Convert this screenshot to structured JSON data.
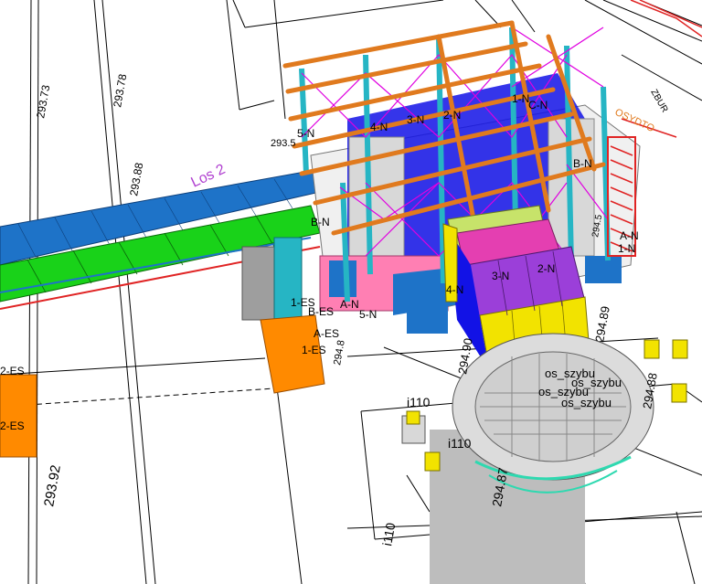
{
  "view": {
    "background": "#ffffff",
    "colors": {
      "bridge_deck": "#1e73c8",
      "bridge_truss": "#19d219",
      "beam": "#e07a1e",
      "column": "#26b5c4",
      "magenta": "#e000e0",
      "blue_panel": "#1212e6",
      "yellow_block": "#f2e300",
      "purple_block": "#9b3fd9",
      "pink_block": "#e43fb1",
      "orange_block": "#ff8a00",
      "silo": "#bdbdbd",
      "teal_dish": "#2ed9b0",
      "red_rail": "#e02424",
      "grey_panel": "#d8d8d8",
      "line": "#000000"
    }
  },
  "labels": {
    "elev_293_73": "293.73",
    "elev_293_78": "293.78",
    "elev_293_88": "293.88",
    "elev_293_92": "293.92",
    "elev_293_5": "293.5",
    "los2": "Los 2",
    "n_1": "1-N",
    "n_2": "2-N",
    "n_3": "3-N",
    "n_4": "4-N",
    "n_5": "5-N",
    "n_c": "C-N",
    "n_b": "B-N",
    "n_a": "A-N",
    "n_b_left": "B-N",
    "n_a_right": "A-N",
    "n_1_right": "1-N",
    "n_3_block": "3-N",
    "n_2_block": "2-N",
    "n_4_block": "4-N",
    "n_a_low": "A-N",
    "n_5_low": "5-N",
    "es_1": "1-ES",
    "es_b": "B-ES",
    "es_a": "A-ES",
    "es_1_low": "1-ES",
    "es_2_top": "2-ES",
    "es_2_bot": "2-ES",
    "elev_294_8": "294.8",
    "elev_294_90": "294.90",
    "elev_294_89": "294.89",
    "elev_294_88": "294.88",
    "elev_294_87": "294.87",
    "elev_294_5": "294.5",
    "i110_a": "i110",
    "i110_b": "i110",
    "i110_c": "i110",
    "os_1": "os_szybu",
    "os_2": "os_szybu",
    "os_3": "os_szybu",
    "os_4": "os_szybu",
    "road_text": "OSYDTO",
    "road_text_b": "ZBUR"
  }
}
